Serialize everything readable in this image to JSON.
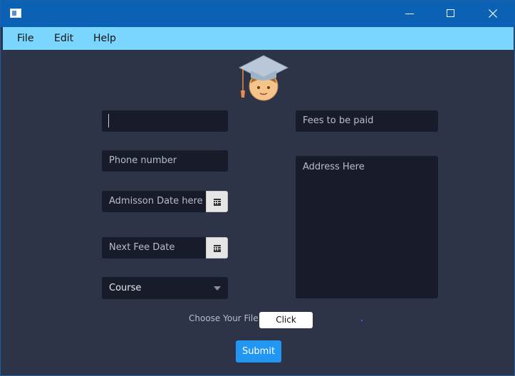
{
  "window": {
    "controls": {
      "minimize": "minimize-icon",
      "maximize": "maximize-icon",
      "close": "close-icon"
    }
  },
  "menubar": {
    "items": [
      "File",
      "Edit",
      "Help"
    ]
  },
  "form": {
    "name_field": {
      "value": "",
      "placeholder": ""
    },
    "fees_field": {
      "placeholder": "Fees to be paid"
    },
    "phone_field": {
      "placeholder": "Phone number"
    },
    "address_field": {
      "placeholder": "Address Here"
    },
    "admission_date": {
      "placeholder": "Admisson Date here",
      "icon": "calendar-icon"
    },
    "next_fee_date": {
      "placeholder": "Next Fee Date",
      "icon": "calendar-icon"
    },
    "course": {
      "selected": "Course",
      "icon": "chevron-down-icon"
    },
    "file_label": "Choose Your File",
    "file_button": "Click",
    "submit_label": "Submit"
  },
  "colors": {
    "titlebar": "#0b62b5",
    "menubar": "#7ad6ff",
    "background": "#2e3447",
    "field": "#181c2a",
    "submit": "#2196f3"
  }
}
